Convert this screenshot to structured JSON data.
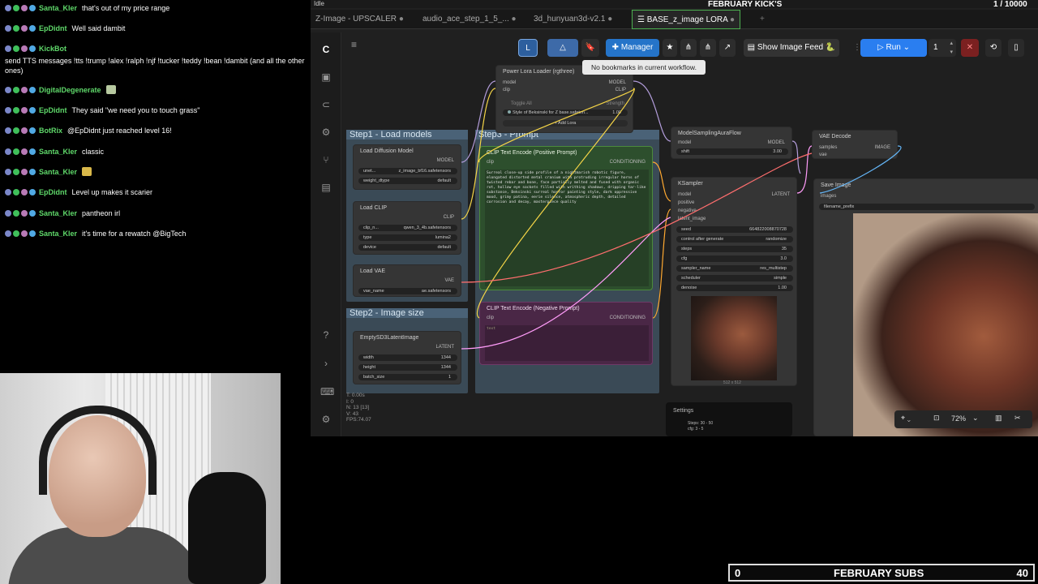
{
  "stream": {
    "window_status": "Idle",
    "goal_title": "FEBRUARY KICK'S",
    "goal_count": "1 / 10000",
    "subs_left": "0",
    "subs_title": "FEBRUARY SUBS",
    "subs_right": "40"
  },
  "chat": [
    {
      "user": "Santa_Kler",
      "color": "#5fd86a",
      "text": "that's out of my price range"
    },
    {
      "user": "EpDidnt",
      "color": "#5fd86a",
      "text": "Well said dambit"
    },
    {
      "user": "KickBot",
      "color": "#5fd86a",
      "text": ""
    },
    {
      "user": "",
      "color": "#ffffff",
      "text": "send TTS messages !tts !trump !alex !ralph !njf !tucker !teddy !bean !dambit (and all the other ones)"
    },
    {
      "user": "DigitalDegenerate",
      "color": "#5fd86a",
      "text": ""
    },
    {
      "user": "EpDidnt",
      "color": "#5fd86a",
      "text": "They said \"we need you to touch grass\""
    },
    {
      "user": "BotRix",
      "color": "#5fd86a",
      "text": "@EpDidnt just reached level 16!"
    },
    {
      "user": "Santa_Kler",
      "color": "#5fd86a",
      "text": "classic"
    },
    {
      "user": "Santa_Kler",
      "color": "#5fd86a",
      "text": ""
    },
    {
      "user": "EpDidnt",
      "color": "#5fd86a",
      "text": "Level up makes it scarier"
    },
    {
      "user": "Santa_Kler",
      "color": "#5fd86a",
      "text": "pantheon irl"
    },
    {
      "user": "Santa_Kler",
      "color": "#5fd86a",
      "text": "it's time for a rewatch @BigTech"
    }
  ],
  "tabs": [
    {
      "label": "Z-Image - UPSCALER"
    },
    {
      "label": "audio_ace_step_1_5_..."
    },
    {
      "label": "3d_hunyuan3d-v2.1"
    },
    {
      "label": "BASE_z_image LORA"
    }
  ],
  "toolbar": {
    "manager_label": "Manager",
    "show_feed_label": "Show Image Feed",
    "run_label": "Run",
    "run_count": "1",
    "tooltip": "No bookmarks in current workflow."
  },
  "groups": {
    "load_models": "Step1 - Load models",
    "image_size": "Step2 - Image size",
    "prompt": "Step3 - Prompt"
  },
  "nodes": {
    "lora": {
      "title": "Power Lora Loader (rgthree)",
      "in_model": "model",
      "in_clip": "clip",
      "out_model": "MODEL",
      "out_clip": "CLIP",
      "toggle": "Toggle All",
      "strength": "Strength",
      "lora_name": "Style of Beksinski for Z base.safeten...",
      "lora_value": "1.00",
      "add": "+ Add Lora"
    },
    "diffusion": {
      "title": "Load Diffusion Model",
      "out": "MODEL",
      "unet_label": "unet...",
      "unet_value": "z_image_bf16.safetensors",
      "dtype_label": "weight_dtype",
      "dtype_value": "default"
    },
    "clip": {
      "title": "Load CLIP",
      "out": "CLIP",
      "name_label": "clip_n...",
      "name_value": "qwen_3_4b.safetensors",
      "type_label": "type",
      "type_value": "lumina2",
      "device_label": "device",
      "device_value": "default"
    },
    "vae": {
      "title": "Load VAE",
      "out": "VAE",
      "name_label": "vae_name",
      "name_value": "ae.safetensors"
    },
    "latent": {
      "title": "EmptySD3LatentImage",
      "out": "LATENT",
      "width_label": "width",
      "width_value": "1344",
      "height_label": "height",
      "height_value": "1344",
      "batch_label": "batch_size",
      "batch_value": "1"
    },
    "pos": {
      "title": "CLIP Text Encode (Positive Prompt)",
      "in": "clip",
      "out": "CONDITIONING",
      "text": "Surreal close-up side profile of a nightmarish robotic figure, elongated distorted metal cranium with protruding irregular horns of twisted rebar and bone, face partially melted and fused with organic rot, hollow eye sockets filled with writhing shadows, dripping tar-like substance, Beksinski surreal horror painting style, dark oppressive mood, grimy patina, eerie silence, atmospheric depth, detailed corrosion and decay, masterpiece quality"
    },
    "neg": {
      "title": "CLIP Text Encode (Negative Prompt)",
      "in": "clip",
      "out": "CONDITIONING",
      "text": "text"
    },
    "msaf": {
      "title": "ModelSamplingAuraFlow",
      "in": "model",
      "out": "MODEL",
      "shift_label": "shift",
      "shift_value": "3.00"
    },
    "ksampler": {
      "title": "KSampler",
      "in_model": "model",
      "in_pos": "positive",
      "in_neg": "negative",
      "in_latent": "latent_image",
      "out": "LATENT",
      "seed_label": "seed",
      "seed_value": "664822008870728",
      "cag_label": "control after generate",
      "cag_value": "randomize",
      "steps_label": "steps",
      "steps_value": "35",
      "cfg_label": "cfg",
      "cfg_value": "3.0",
      "sampler_label": "sampler_name",
      "sampler_value": "res_multistep",
      "sched_label": "scheduler",
      "sched_value": "simple",
      "denoise_label": "denoise",
      "denoise_value": "1.00",
      "preview_caption": "512 x 512"
    },
    "vaedec": {
      "title": "VAE Decode",
      "in_samples": "samples",
      "in_vae": "vae",
      "out": "IMAGE"
    },
    "save": {
      "title": "Save Image",
      "in": "images",
      "prefix": "filename_prefix"
    },
    "settings": {
      "title": "Settings",
      "line1": "Steps: 30 - 50",
      "line2": "cfg: 3 - 5"
    }
  },
  "status": {
    "l1": "T: 0.00s",
    "l2": "I: 0",
    "l3": "N: 13 [13]",
    "l4": "V: 43",
    "l5": "FPS:74.07"
  },
  "zoom": {
    "value": "72%"
  },
  "colors": {
    "accent": "#2a7ef0",
    "model_wire": "#b39ddb",
    "clip_wire": "#f5d547",
    "latent_wire": "#ff9cf9",
    "cond_wire": "#ffa931",
    "vae_wire": "#ff6e6e",
    "image_wire": "#64b5f6"
  }
}
